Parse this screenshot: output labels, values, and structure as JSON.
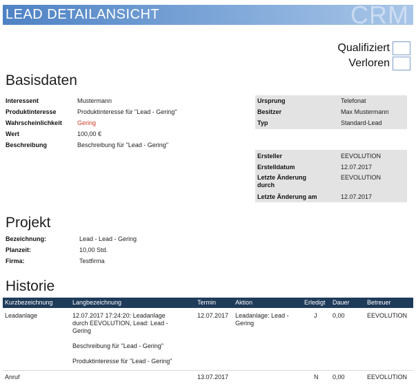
{
  "header": {
    "title": "LEAD DETAILANSICHT",
    "logo": "CRM"
  },
  "flags": [
    {
      "label": "Qualifiziert",
      "checked": false
    },
    {
      "label": "Verloren",
      "checked": false
    }
  ],
  "basisdaten": {
    "title": "Basisdaten",
    "fields": [
      {
        "key": "Interessent",
        "value": "Mustermann"
      },
      {
        "key": "Produktinteresse",
        "value": "Produktinteresse für \"Lead - Gering\""
      },
      {
        "key": "Wahrscheinlichkeit",
        "value": "Gering"
      },
      {
        "key": "Wert",
        "value": "100,00 €"
      },
      {
        "key": "Beschreibung",
        "value": "Beschreibung für \"Lead - Gering\""
      }
    ],
    "source_fields": [
      {
        "key": "Ursprung",
        "value": "Telefonat"
      },
      {
        "key": "Besitzer",
        "value": "Max Mustermann"
      },
      {
        "key": "Typ",
        "value": "Standard-Lead"
      }
    ],
    "meta_fields": [
      {
        "key": "Ersteller",
        "value": "EEVOLUTION"
      },
      {
        "key": "Erstelldatum",
        "value": "12.07.2017"
      },
      {
        "key": "Letzte Änderung durch",
        "value": "EEVOLUTION"
      },
      {
        "key": "Letzte Änderung am",
        "value": "12.07.2017"
      }
    ],
    "colors": {
      "probability_low": "#d03a2a"
    }
  },
  "projekt": {
    "title": "Projekt",
    "fields": [
      {
        "key": "Bezeichnung:",
        "value": "Lead - Lead - Gering"
      },
      {
        "key": "Planzeit:",
        "value": "10,00 Std."
      },
      {
        "key": "Firma:",
        "value": "Testfirma"
      }
    ]
  },
  "historie": {
    "title": "Historie",
    "columns": [
      "Kurzbezeichnung",
      "Langbezeichnung",
      "Termin",
      "Aktion",
      "Erledigt",
      "Dauer",
      "Betreuer"
    ],
    "rows": [
      {
        "kurz": "Leadanlage",
        "lang": [
          "12.07.2017 17:24:20: Leadanlage",
          "durch EEVOLUTION, Lead: Lead -",
          "Gering",
          "",
          "Beschreibung für \"Lead - Gering\"",
          "",
          "Produktinteresse für \"Lead - Gering\""
        ],
        "termin": "12.07.2017",
        "aktion": [
          "Leadanlage: Lead -",
          "Gering"
        ],
        "erledigt": "J",
        "dauer": "0,00",
        "betreuer": "EEVOLUTION"
      },
      {
        "kurz": "Anruf",
        "lang": [],
        "termin": "13.07.2017",
        "aktion": [],
        "erledigt": "N",
        "dauer": "0,00",
        "betreuer": "EEVOLUTION"
      }
    ],
    "header_color": "#1e3b5a"
  }
}
